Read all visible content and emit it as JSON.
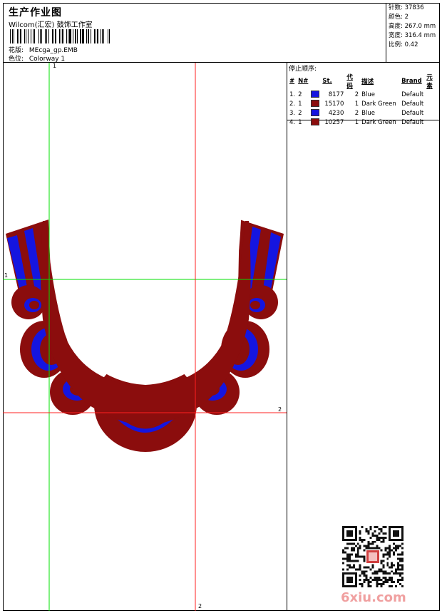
{
  "header": {
    "title": "生产作业图",
    "subtitle": "Wilcom(汇宏) 鼓饰工作室",
    "design_label": "花版:",
    "design_value": "MEcga_gp.EMB",
    "colorway_label": "色位:",
    "colorway_value": "Colorway 1"
  },
  "stats": {
    "stitches": "针数: 37836",
    "colors": "颜色: 2",
    "height": "高度: 267.0 mm",
    "width": "宽度: 316.4 mm",
    "scale": "比例: 0.42"
  },
  "stop_sequence": {
    "title": "停止顺序:",
    "headers": [
      "#",
      "N#",
      "St.",
      "代码",
      "描述",
      "Brand",
      "元素"
    ],
    "rows": [
      {
        "idx": "1.",
        "n": "2",
        "color": "#1515e0",
        "st": "8177",
        "code": "2",
        "desc": "Blue",
        "brand": "Default"
      },
      {
        "idx": "2.",
        "n": "1",
        "color": "#8b0d0d",
        "st": "15170",
        "code": "1",
        "desc": "Dark Green",
        "brand": "Default"
      },
      {
        "idx": "3.",
        "n": "2",
        "color": "#1515e0",
        "st": "4230",
        "code": "2",
        "desc": "Blue",
        "brand": "Default"
      },
      {
        "idx": "4.",
        "n": "1",
        "color": "#8b0d0d",
        "st": "10257",
        "code": "1",
        "desc": "Dark Green",
        "brand": "Default"
      }
    ]
  },
  "guides": {
    "green_v_label": "1",
    "green_h_label": "1",
    "red_h_label": "2",
    "red_v_label": "2"
  },
  "colors": {
    "maroon": "#8b0d0d",
    "blue": "#1515e0",
    "guide_green": "#00e000",
    "guide_red": "#ff2020"
  },
  "watermark": {
    "text": "6xiu.com"
  }
}
